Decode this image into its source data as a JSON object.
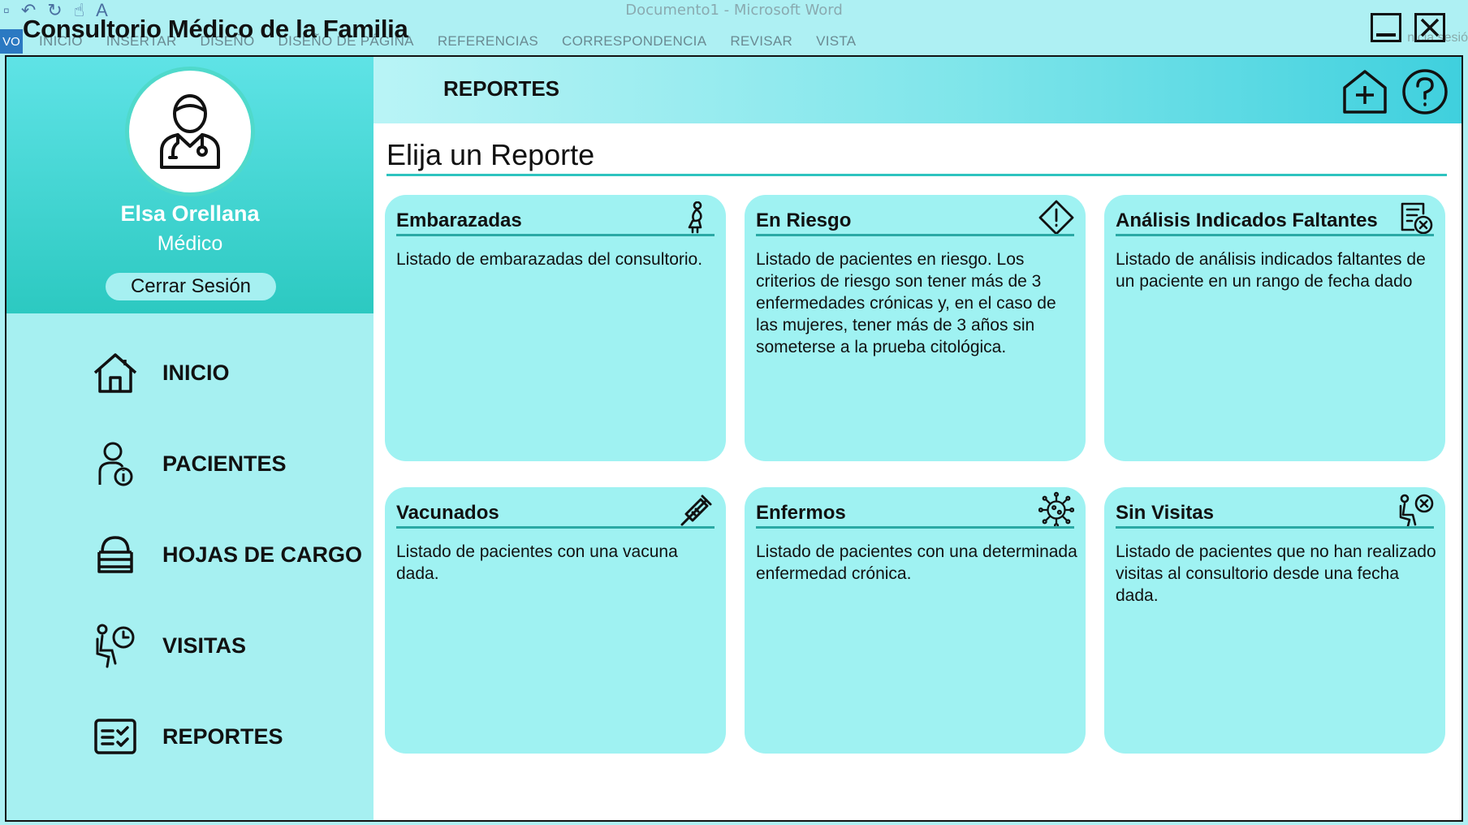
{
  "word": {
    "document_title": "Documento1 - Microsoft Word",
    "file_tab": "VO",
    "tabs": [
      "INICIO",
      "INSERTAR",
      "DISEÑO",
      "DISEÑO DE PÁGINA",
      "REFERENCIAS",
      "CORRESPONDENCIA",
      "REVISAR",
      "VISTA"
    ],
    "signin_fragment": "nicia sesió"
  },
  "app": {
    "title": "Consultorio Médico de la Familia"
  },
  "user": {
    "name": "Elsa Orellana",
    "role": "Médico",
    "logout_label": "Cerrar Sesión"
  },
  "nav": {
    "items": [
      {
        "label": "INICIO",
        "icon": "home-icon"
      },
      {
        "label": "PACIENTES",
        "icon": "patient-info-icon"
      },
      {
        "label": "HOJAS DE CARGO",
        "icon": "document-stack-icon"
      },
      {
        "label": "VISITAS",
        "icon": "waiting-clock-icon"
      },
      {
        "label": "REPORTES",
        "icon": "report-checklist-icon"
      }
    ]
  },
  "header": {
    "title": "REPORTES"
  },
  "main": {
    "section_title": "Elija un Reporte"
  },
  "reports": [
    {
      "title": "Embarazadas",
      "icon": "pregnant-icon",
      "description": "Listado de embarazadas del consultorio."
    },
    {
      "title": "En Riesgo",
      "icon": "warning-diamond-icon",
      "description": "Listado de pacientes en riesgo. Los criterios de riesgo son tener más de 3 enfermedades crónicas y, en el caso de las mujeres, tener más de 3 años sin someterse a la prueba citológica."
    },
    {
      "title": "Análisis Indicados Faltantes",
      "icon": "missing-analysis-icon",
      "description": "Listado de análisis indicados faltantes de un paciente en un rango de fecha dado"
    },
    {
      "title": "Vacunados",
      "icon": "syringe-icon",
      "description": "Listado de pacientes con una vacuna dada."
    },
    {
      "title": "Enfermos",
      "icon": "virus-icon",
      "description": "Listado de pacientes con una determinada enfermedad crónica."
    },
    {
      "title": "Sin Visitas",
      "icon": "no-visit-icon",
      "description": "Listado de pacientes que no han realizado visitas al consultorio desde una fecha dada."
    }
  ],
  "colors": {
    "background": "#aef0f3",
    "profile_top": "#5fe3e6",
    "profile_bottom": "#2cc9c1",
    "card": "#9ff2f2",
    "accent_rule": "#2ec3bf"
  }
}
